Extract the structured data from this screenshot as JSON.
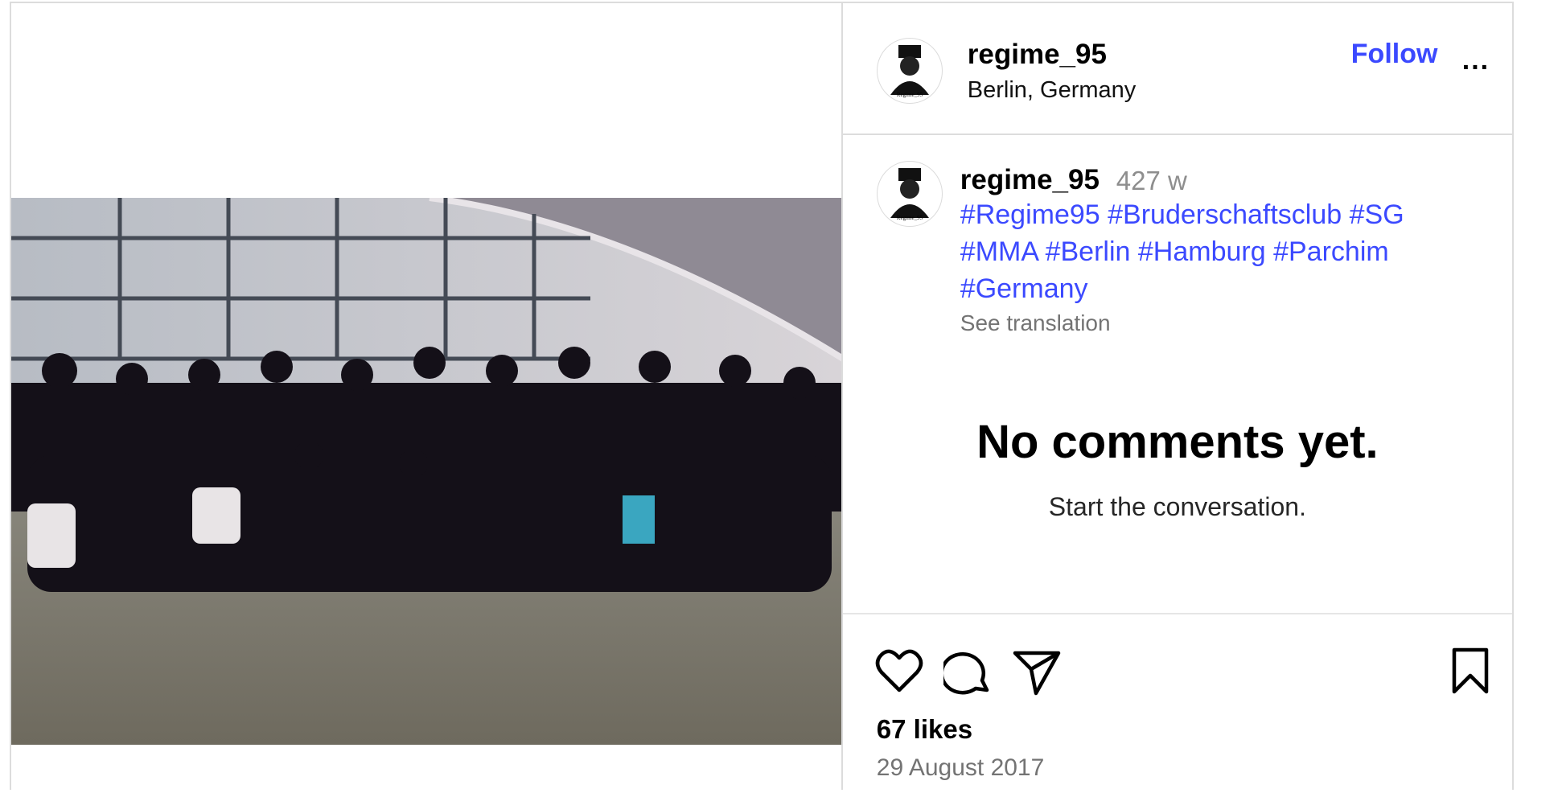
{
  "post": {
    "username": "regime_95",
    "location": "Berlin, Germany",
    "follow_label": "Follow",
    "more_label": "...",
    "avatar_text": "Regime_95"
  },
  "caption": {
    "username": "regime_95",
    "time": "427 w",
    "hashtags": [
      "#Regime95",
      "#Bruderschaftsclub",
      "#SG",
      "#MMA",
      "#Berlin",
      "#Hamburg",
      "#Parchim",
      "#Germany"
    ],
    "see_translation": "See translation"
  },
  "comments": {
    "empty_title": "No comments yet.",
    "empty_subtitle": "Start the conversation."
  },
  "footer": {
    "likes": "67 likes",
    "date": "29 August 2017"
  },
  "icons": [
    "heart-icon",
    "comment-icon",
    "share-icon",
    "bookmark-icon",
    "more-icon"
  ]
}
